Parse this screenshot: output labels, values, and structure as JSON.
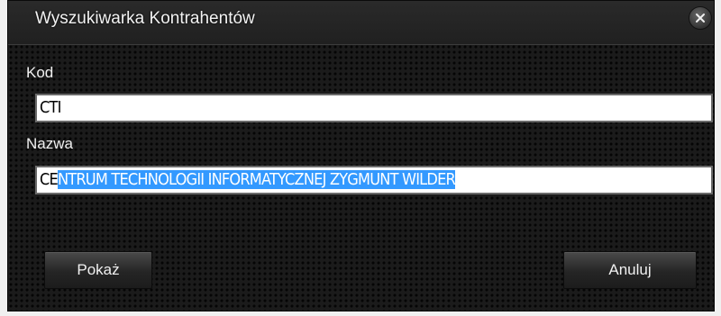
{
  "dialog": {
    "title": "Wyszukiwarka Kontrahentów"
  },
  "form": {
    "kod_label": "Kod",
    "kod_value": "CTI",
    "nazwa_label": "Nazwa",
    "nazwa_typed": "CE",
    "nazwa_autocomplete": "NTRUM TECHNOLOGII INFORMATYCZNEJ ZYGMUNT WILDER"
  },
  "buttons": {
    "show_label": "Pokaż",
    "cancel_label": "Anuluj"
  },
  "icons": {
    "close": "close-icon"
  },
  "colors": {
    "selection": "#3399ff",
    "background": "#1b1b1b"
  }
}
